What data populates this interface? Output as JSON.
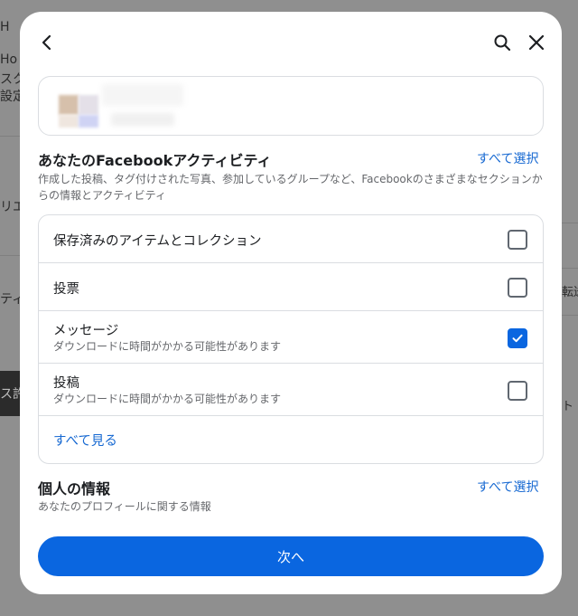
{
  "background": {
    "fragments": [
      "H",
      "Ho",
      "スク",
      "設定",
      "リエ",
      "ティ",
      "ス許",
      "転送",
      "ト ロ"
    ]
  },
  "header": {
    "back_icon": "chevron-left-icon",
    "search_icon": "search-icon",
    "close_icon": "close-icon"
  },
  "facebook_activity": {
    "title": "あなたのFacebookアクティビティ",
    "select_all": "すべて選択",
    "description": "作成した投稿、タグ付けされた写真、参加しているグループなど、Facebookのさまざまなセクションからの情報とアクティビティ",
    "items": [
      {
        "title": "保存済みのアイテムとコレクション",
        "subtitle": "",
        "checked": false
      },
      {
        "title": "投票",
        "subtitle": "",
        "checked": false
      },
      {
        "title": "メッセージ",
        "subtitle": "ダウンロードに時間がかかる可能性があります",
        "checked": true
      },
      {
        "title": "投稿",
        "subtitle": "ダウンロードに時間がかかる可能性があります",
        "checked": false
      }
    ],
    "see_all": "すべて見る"
  },
  "personal_info": {
    "title": "個人の情報",
    "select_all": "すべて選択",
    "description": "あなたのプロフィールに関する情報"
  },
  "footer": {
    "next_label": "次へ"
  },
  "colors": {
    "accent": "#0a66e0",
    "link": "#1769d2",
    "overlay": "#8f8f8f"
  }
}
